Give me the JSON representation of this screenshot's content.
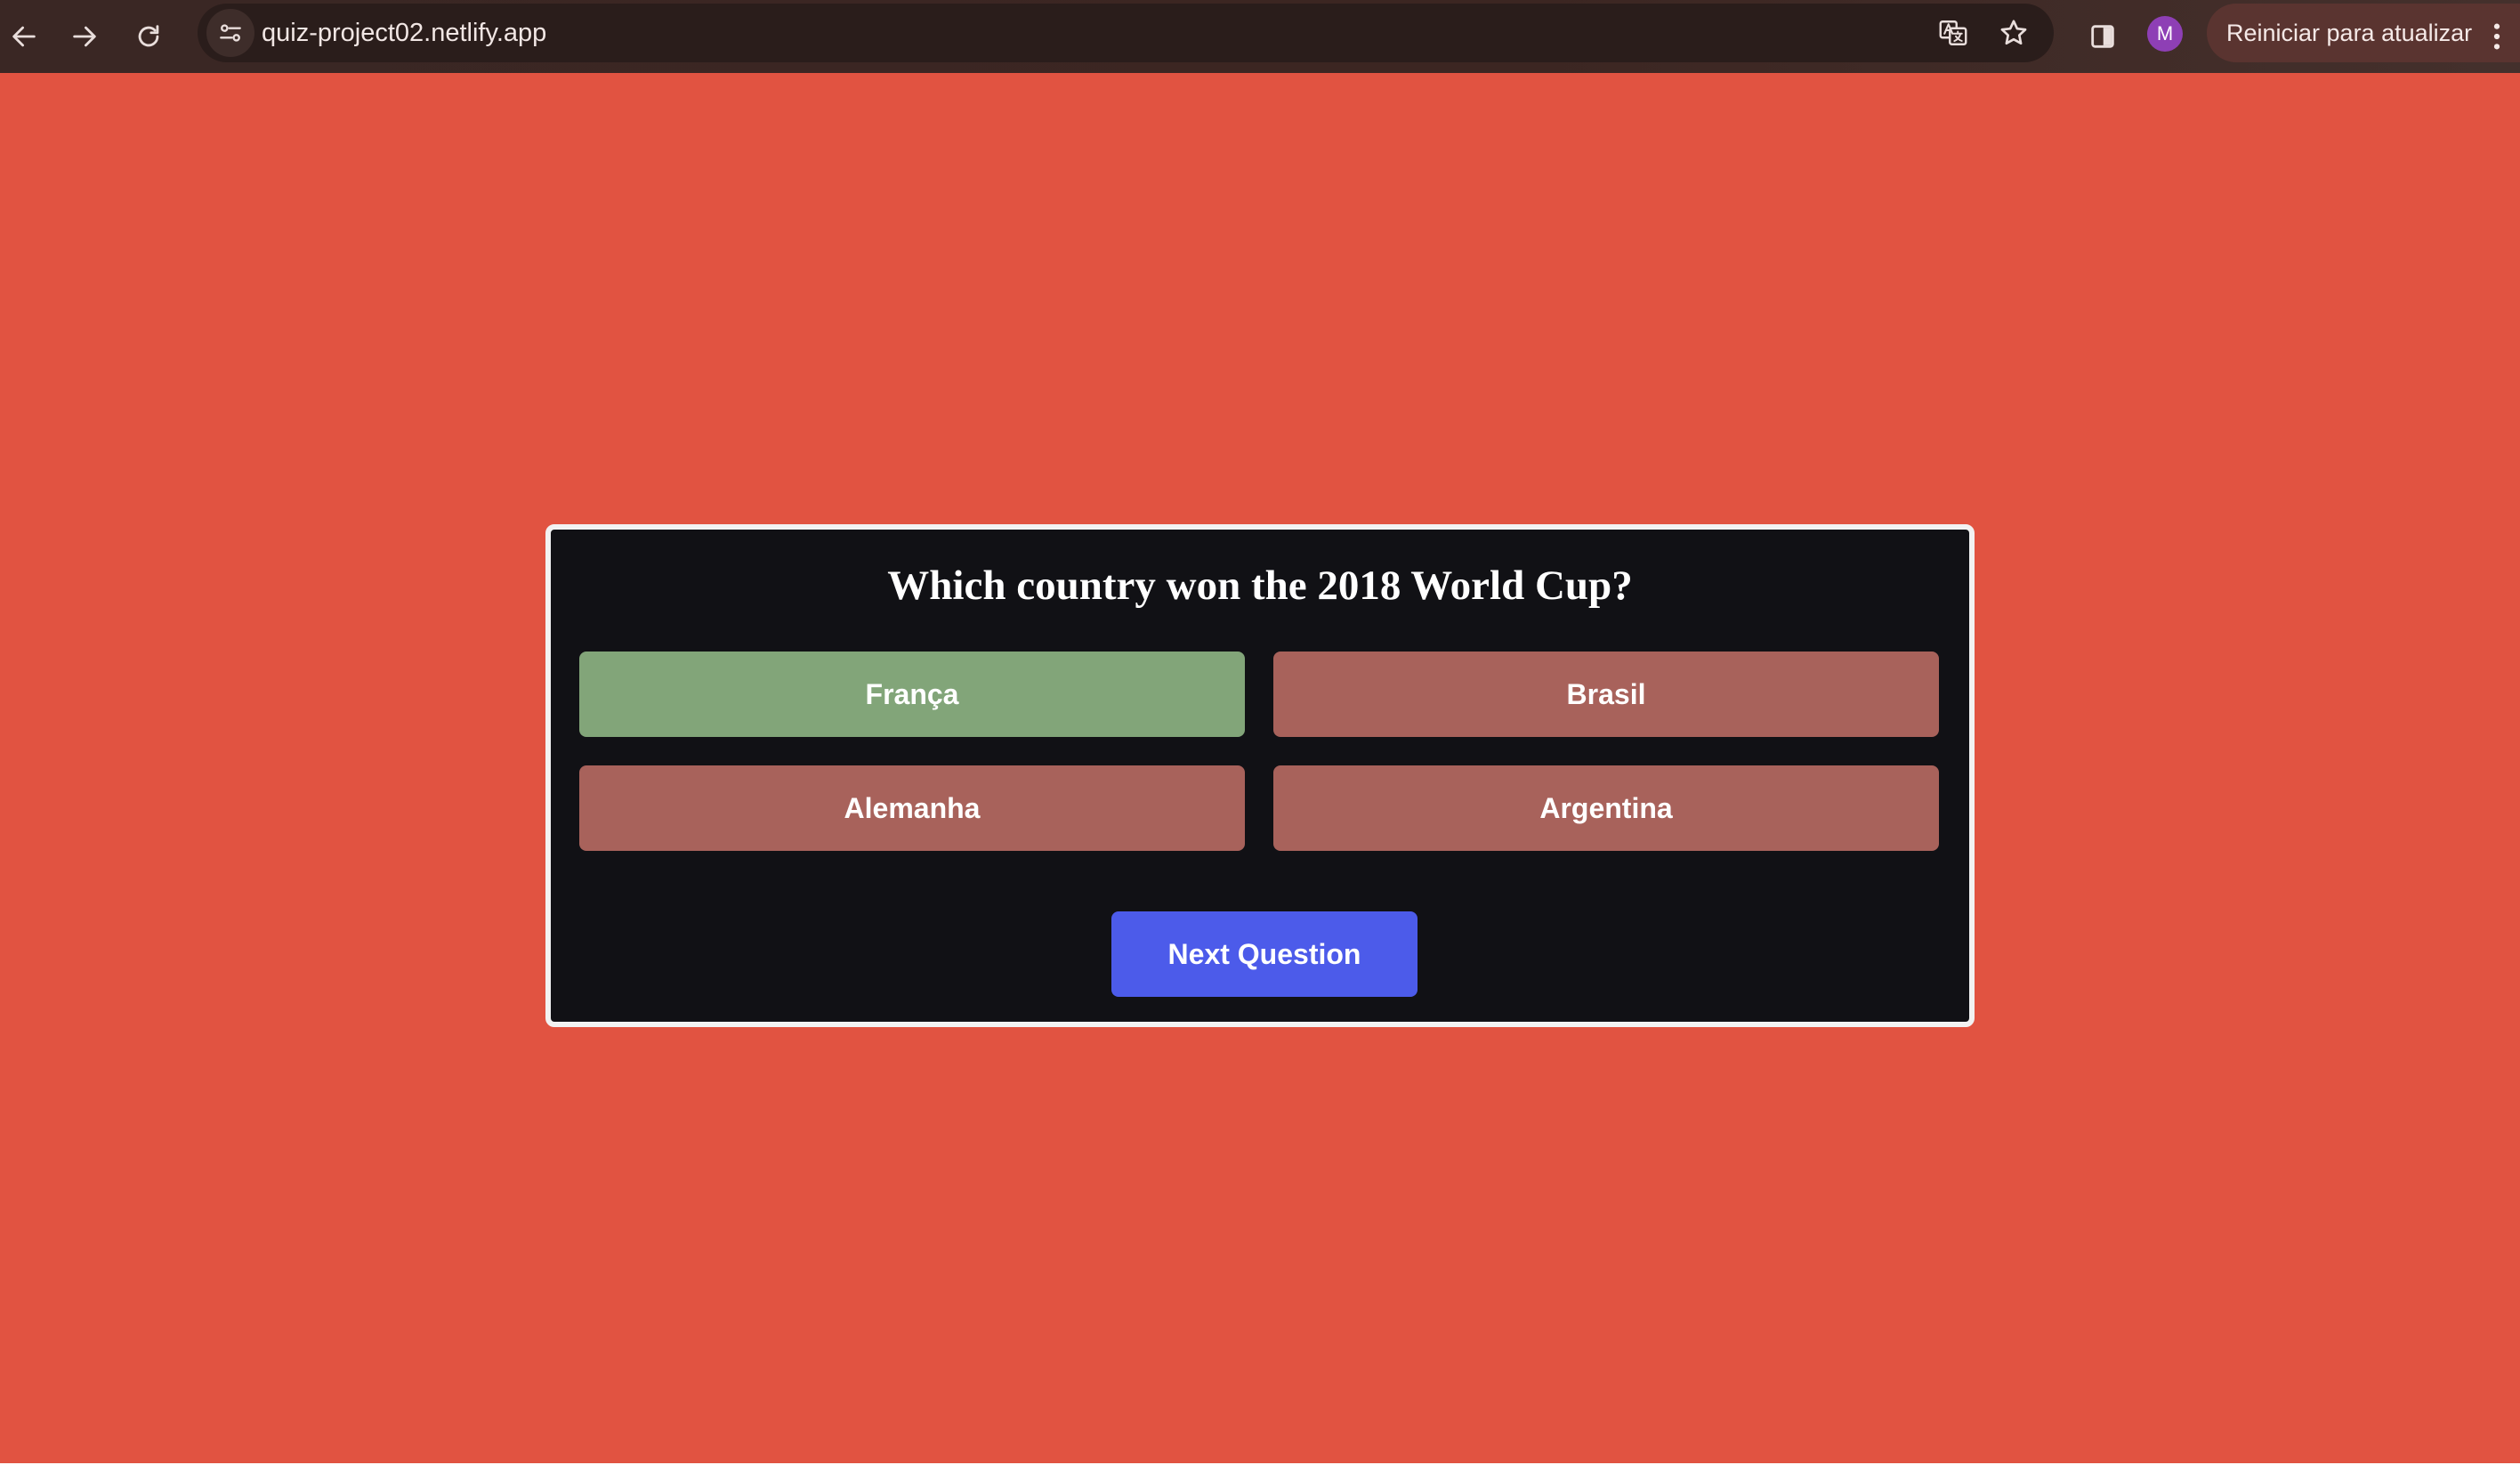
{
  "browser": {
    "url": "quiz-project02.netlify.app",
    "restart_label": "Reiniciar para atualizar",
    "profile_initial": "M",
    "icons": {
      "back": "arrow-left-icon",
      "forward": "arrow-right-icon",
      "reload": "reload-icon",
      "site_info": "site-settings-icon",
      "translate": "translate-icon",
      "bookmark": "star-icon",
      "side_panel": "side-panel-icon",
      "menu": "kebab-menu-icon"
    },
    "colors": {
      "toolbar": "#3a2724",
      "omnibox": "#2a1d1b",
      "avatar": "#8e3fb5",
      "restart_chip": "#5a3430"
    }
  },
  "quiz": {
    "question": "Which country won the 2018 World Cup?",
    "answers": [
      {
        "label": "França",
        "state": "correct"
      },
      {
        "label": "Brasil",
        "state": "wrong"
      },
      {
        "label": "Alemanha",
        "state": "wrong"
      },
      {
        "label": "Argentina",
        "state": "wrong"
      }
    ],
    "next_label": "Next Question",
    "colors": {
      "page_background": "#e15341",
      "card_background": "#111115",
      "card_border": "#f2f2f2",
      "correct": "#82a579",
      "wrong": "#a8625b",
      "next_button": "#4c5bea"
    }
  }
}
